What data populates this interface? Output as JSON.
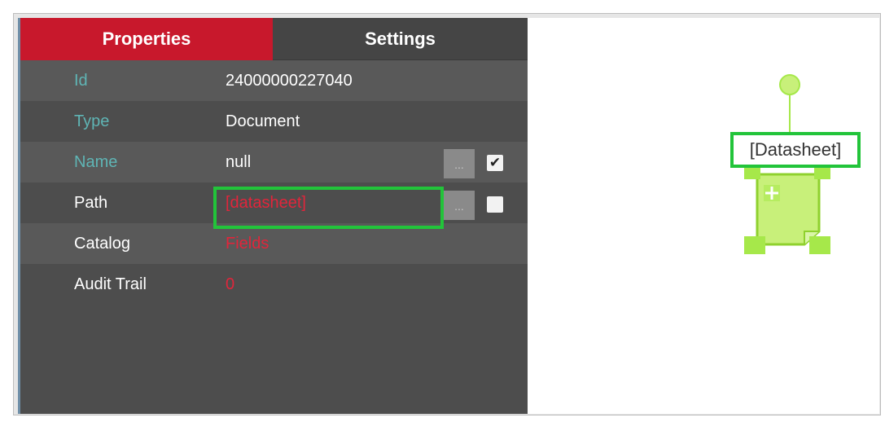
{
  "tabs": {
    "properties": "Properties",
    "settings": "Settings"
  },
  "rows": [
    {
      "label": "Id",
      "value": "24000000227040"
    },
    {
      "label": "Type",
      "value": "Document"
    },
    {
      "label": "Name",
      "value": "null",
      "button": "...",
      "checked": true
    },
    {
      "label": "Path",
      "value": "[datasheet]",
      "button": "...",
      "checked": false
    },
    {
      "label": "Catalog",
      "value": "Fields"
    },
    {
      "label": "Audit Trail",
      "value": "0"
    }
  ],
  "icons": {
    "checkbox_checked": "checkmark-icon",
    "document_node": "document-node-icon"
  },
  "colors": {
    "tab_active": "#c8182c",
    "highlight": "#22c43a",
    "node": "#a6e84a",
    "label_teal": "#5fb5b5",
    "value_red": "#e1253b"
  },
  "canvas": {
    "node_label": "[Datasheet]"
  }
}
